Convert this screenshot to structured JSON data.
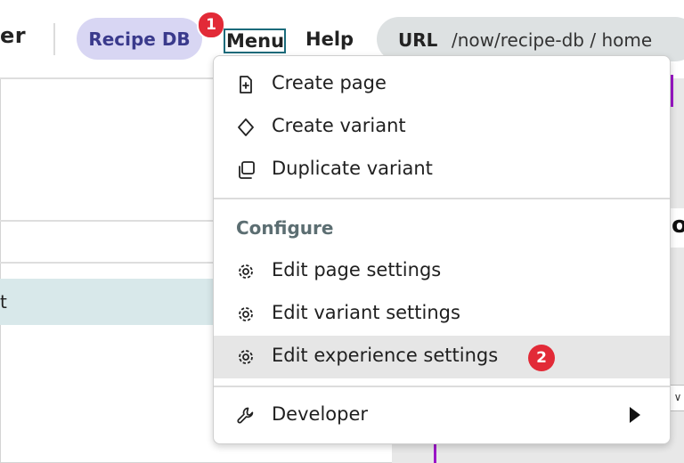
{
  "topbar": {
    "brand_fragment": "er",
    "app_pill": "Recipe DB",
    "step_1": "1",
    "menu_label": "Menu",
    "help_label": "Help",
    "url_label": "URL",
    "url_value": "/now/recipe-db / home"
  },
  "left_pane": {
    "row_text_fragment": "t"
  },
  "right_pane": {
    "edge_glyph": "o",
    "edge_chevron": "∨"
  },
  "dropdown": {
    "items_top": [
      {
        "label": "Create page",
        "icon": "page-add-icon"
      },
      {
        "label": "Create variant",
        "icon": "diamond-icon"
      },
      {
        "label": "Duplicate variant",
        "icon": "duplicate-icon"
      }
    ],
    "section_label": "Configure",
    "items_config": [
      {
        "label": "Edit page settings",
        "icon": "gear-icon"
      },
      {
        "label": "Edit variant settings",
        "icon": "gear-icon"
      },
      {
        "label": "Edit experience settings",
        "icon": "gear-icon"
      }
    ],
    "step_2": "2",
    "developer": {
      "label": "Developer",
      "icon": "wrench-icon"
    }
  },
  "colors": {
    "accent_pill": "#d8d6f3",
    "step_badge": "#e22a37",
    "focus_outline": "#1b6b7b",
    "selected_row": "#d8e8ea",
    "purple_accent": "#9b16c7"
  }
}
